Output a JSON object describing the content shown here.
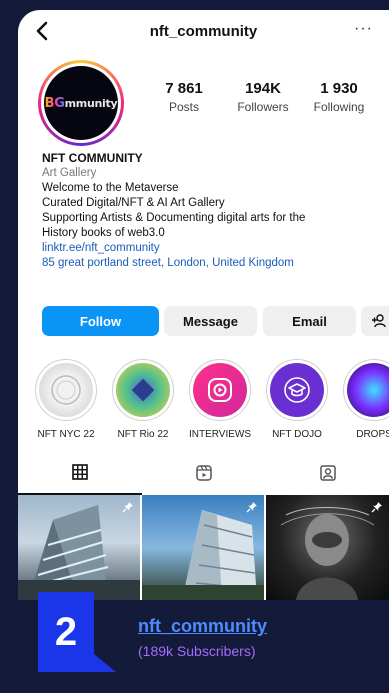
{
  "header": {
    "username": "nft_community",
    "more_glyph": "···"
  },
  "avatar": {
    "logo_text_1": "BG",
    "logo_text_2": "mmunity"
  },
  "stats": [
    {
      "value": "7 861",
      "label": "Posts"
    },
    {
      "value": "194K",
      "label": "Followers"
    },
    {
      "value": "1 930",
      "label": "Following"
    }
  ],
  "bio": {
    "name": "NFT COMMUNITY",
    "category": "Art Gallery",
    "line1": "Welcome to the Metaverse",
    "line2": "Curated Digital/NFT & AI Art Gallery",
    "line3": "Supporting Artists & Documenting digital arts for the",
    "line4": "History books of web3.0",
    "link": "linktr.ee/nft_community",
    "address": "85 great portland street, London, United Kingdom"
  },
  "actions": {
    "follow": "Follow",
    "message": "Message",
    "email": "Email"
  },
  "highlights": [
    {
      "label": "NFT NYC 22"
    },
    {
      "label": "NFT Rio 22"
    },
    {
      "label": "INTERVIEWS"
    },
    {
      "label": "NFT DOJO"
    },
    {
      "label": "DROPS"
    }
  ],
  "footer": {
    "rank": "2",
    "handle": "nft_community",
    "subscribers": "(189k Subscribers)"
  },
  "colors": {
    "follow_blue": "#0a95f6",
    "badge_blue": "#1b35e8",
    "link_blue": "#1a5cb8",
    "handle_blue": "#4e8bff",
    "sub_purple": "#a36bff",
    "bg_navy": "#141a3a"
  },
  "icons": [
    "back-arrow-icon",
    "more-dots-icon",
    "add-person-icon",
    "grid-icon",
    "reels-icon",
    "tagged-icon",
    "pin-icon"
  ]
}
